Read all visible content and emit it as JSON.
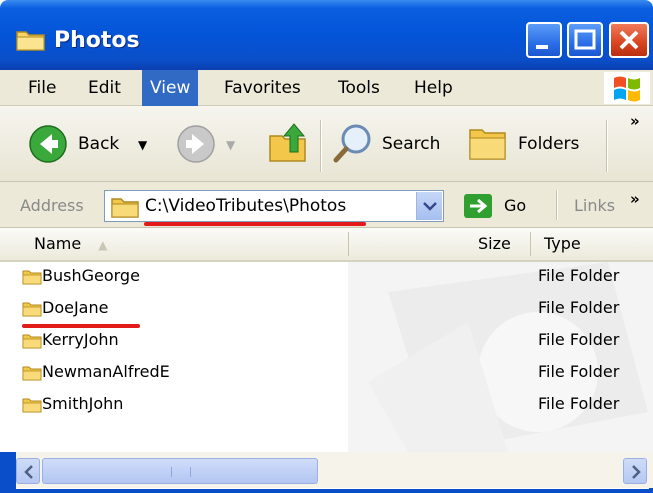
{
  "window": {
    "title": "Photos"
  },
  "menu": {
    "items": [
      {
        "label": "File"
      },
      {
        "label": "Edit"
      },
      {
        "label": "View",
        "active": true
      },
      {
        "label": "Favorites"
      },
      {
        "label": "Tools"
      },
      {
        "label": "Help"
      }
    ]
  },
  "toolbar": {
    "back_label": "Back",
    "search_label": "Search",
    "folders_label": "Folders",
    "overflow": "»"
  },
  "address": {
    "label": "Address",
    "value": "C:\\VideoTributes\\Photos",
    "go_label": "Go",
    "links_label": "Links",
    "overflow": "»"
  },
  "columns": {
    "name": "Name",
    "size": "Size",
    "type": "Type"
  },
  "files": [
    {
      "name": "BushGeorge",
      "type": "File Folder"
    },
    {
      "name": "DoeJane",
      "type": "File Folder"
    },
    {
      "name": "KerryJohn",
      "type": "File Folder"
    },
    {
      "name": "NewmanAlfredE",
      "type": "File Folder"
    },
    {
      "name": "SmithJohn",
      "type": "File Folder"
    }
  ],
  "colors": {
    "titlebar_blue": "#0454d8",
    "menu_highlight": "#316ac5",
    "annotation_red": "#e21a1a",
    "folder_yellow": "#f3c74a"
  }
}
